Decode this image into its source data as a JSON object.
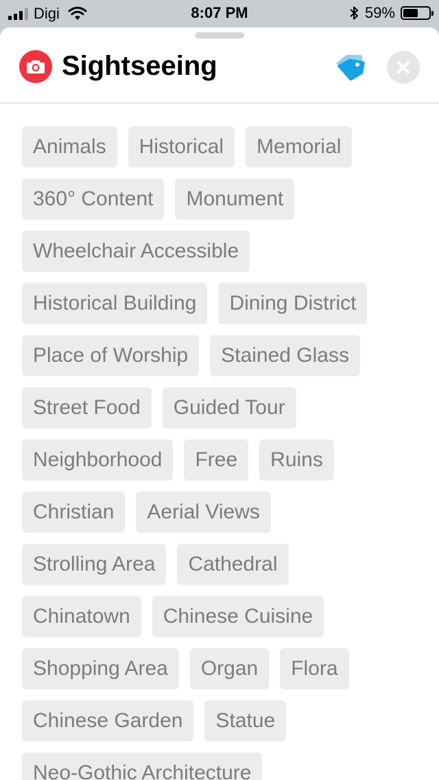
{
  "status_bar": {
    "carrier": "Digi",
    "time": "8:07 PM",
    "battery_percent": "59%",
    "battery_level": 0.59,
    "signal_bars": 3,
    "icons": [
      "signal-bars-icon",
      "wifi-icon",
      "bluetooth-icon",
      "battery-icon"
    ]
  },
  "header": {
    "title": "Sightseeing",
    "category_icon": "camera-icon",
    "tag_icon": "tag-icon",
    "close_icon": "close-icon"
  },
  "colors": {
    "category_accent": "#ef3340",
    "tag_accent": "#1aa1e6",
    "chip_background": "#ececee",
    "chip_text": "#7c7c80"
  },
  "tags": [
    "Animals",
    "Historical",
    "Memorial",
    "360° Content",
    "Monument",
    "Wheelchair Accessible",
    "Historical Building",
    "Dining District",
    "Place of Worship",
    "Stained Glass",
    "Street Food",
    "Guided Tour",
    "Neighborhood",
    "Free",
    "Ruins",
    "Christian",
    "Aerial Views",
    "Strolling Area",
    "Cathedral",
    "Chinatown",
    "Chinese Cuisine",
    "Shopping Area",
    "Organ",
    "Flora",
    "Chinese Garden",
    "Statue",
    "Neo-Gothic Architecture"
  ]
}
